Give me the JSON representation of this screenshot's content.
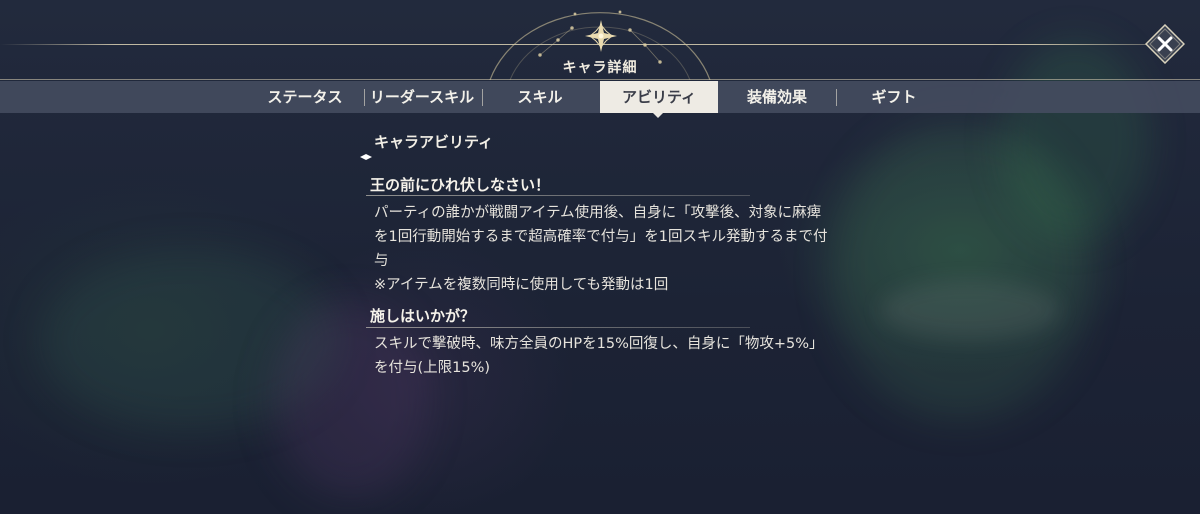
{
  "header": {
    "title": "キャラ詳細",
    "close_icon": "close-icon",
    "emblem_icon": "compass-star-icon"
  },
  "tabs": [
    {
      "label": "ステータス",
      "active": false
    },
    {
      "label": "リーダースキル",
      "active": false
    },
    {
      "label": "スキル",
      "active": false
    },
    {
      "label": "アビリティ",
      "active": true
    },
    {
      "label": "装備効果",
      "active": false
    },
    {
      "label": "ギフト",
      "active": false
    }
  ],
  "content": {
    "section_title": "キャラアビリティ",
    "abilities": [
      {
        "name": "王の前にひれ伏しなさい！",
        "description": "パーティの誰かが戦闘アイテム使用後、自身に「攻撃後、対象に麻痺\nを1回行動開始するまで超高確率で付与」を1回スキル発動するまで付\n与\n※アイテムを複数同時に使用しても発動は1回"
      },
      {
        "name": "施しはいかが？",
        "description": "スキルで撃破時、味方全員のHPを15%回復し、自身に「物攻+5%」\nを付与(上限15%)"
      }
    ]
  },
  "colors": {
    "accent_gold": "#e2d2a0",
    "tab_active_bg": "#eeebe4",
    "tab_bar_bg": "#464e62"
  }
}
